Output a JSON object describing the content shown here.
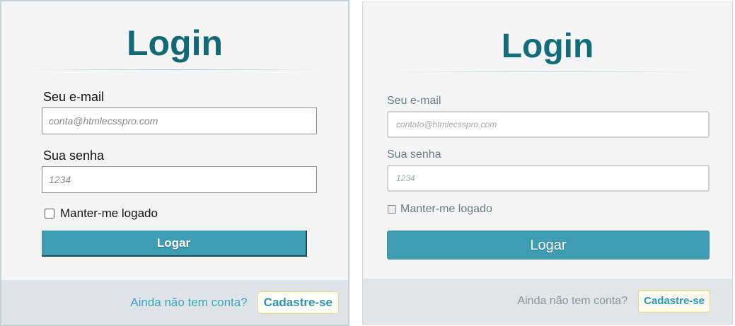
{
  "left_form": {
    "title": "Login",
    "email_label": "Seu e-mail",
    "email_placeholder": "conta@htmlecsspro.com",
    "password_label": "Sua senha",
    "password_placeholder": "1234",
    "remember_label": "Manter-me logado",
    "remember_checked": false,
    "submit_label": "Logar",
    "footer_text": "Ainda não tem conta?",
    "signup_label": "Cadastre-se"
  },
  "right_form": {
    "title": "Login",
    "email_label": "Seu e-mail",
    "email_placeholder": "contato@htmlecsspro.com",
    "password_label": "Sua senha",
    "password_placeholder": "1234",
    "remember_label": "Manter-me logado",
    "remember_checked": false,
    "submit_label": "Logar",
    "footer_text": "Ainda não tem conta?",
    "signup_label": "Cadastre-se"
  },
  "colors": {
    "title": "#136873",
    "button": "#3e9db3",
    "link": "#3aa6c1",
    "signup_border": "#e6dc95"
  }
}
